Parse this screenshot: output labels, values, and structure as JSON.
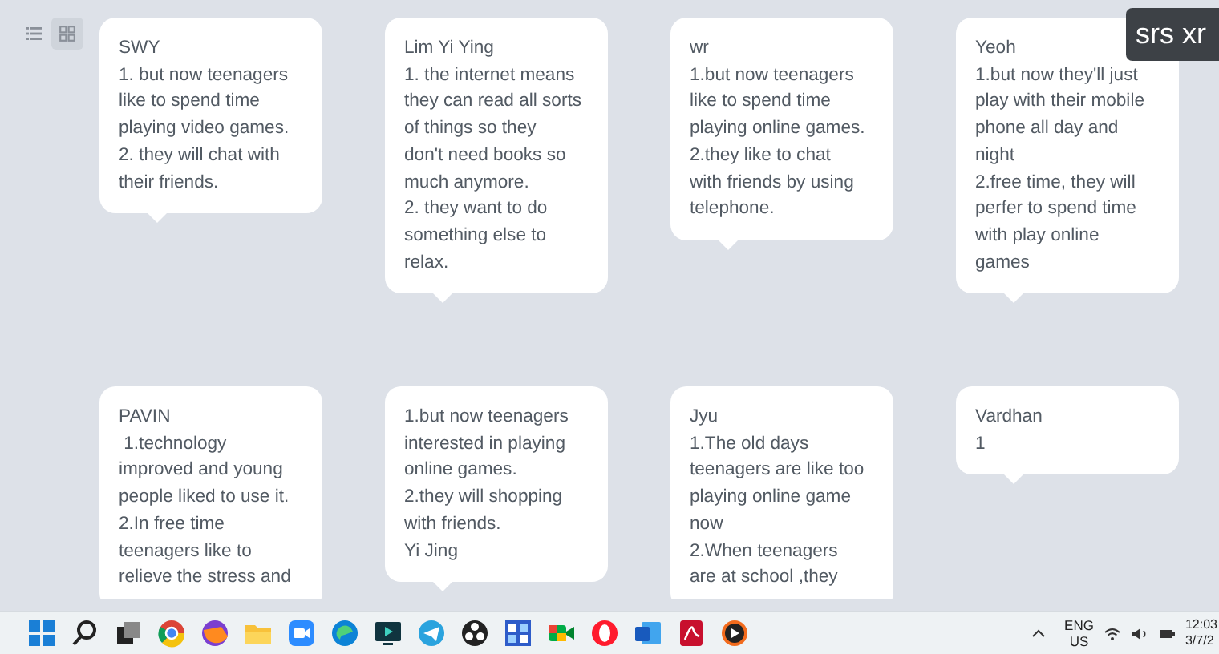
{
  "view_toggle": [
    {
      "kind": "list",
      "selected": false
    },
    {
      "kind": "grid",
      "selected": true
    }
  ],
  "overlay_label": "srs xr",
  "posts": [
    {
      "author": "SWY",
      "text": "1. but now teenagers\nlike to spend time\nplaying video games.\n2. they will chat with\ntheir friends."
    },
    {
      "author": "Lim Yi Ying",
      "text": "1. the internet means\nthey can read all sorts\nof things so they\ndon't need books so\nmuch anymore.\n2. they want to do\nsomething else to\nrelax."
    },
    {
      "author": "wr",
      "text": "1.but now teenagers\nlike to spend time\nplaying online games.\n2.they like to chat\nwith friends by using\ntelephone."
    },
    {
      "author": "Yeoh",
      "text": "1.but now they'll just\nplay with their mobile\nphone all day and\nnight\n2.free time, they will\nperfer to spend time\nwith play online\ngames"
    },
    {
      "author": "PAVIN",
      "text": " 1.technology\nimproved and young\npeople liked to use it.\n2.In free time\nteenagers like to\nrelieve the stress and"
    },
    {
      "text": "1.but now teenagers\ninterested in playing\nonline games.\n2.they will shopping\nwith friends.\nYi Jing"
    },
    {
      "author": "Jyu",
      "text": "1.The old days\nteenagers are like too\nplaying online game\nnow\n2.When teenagers\nare at school ,they"
    },
    {
      "author": "Vardhan",
      "text": "1"
    }
  ],
  "taskbar": {
    "language": "ENG",
    "region": "US",
    "time": "12:03",
    "date": "3/7/2"
  }
}
